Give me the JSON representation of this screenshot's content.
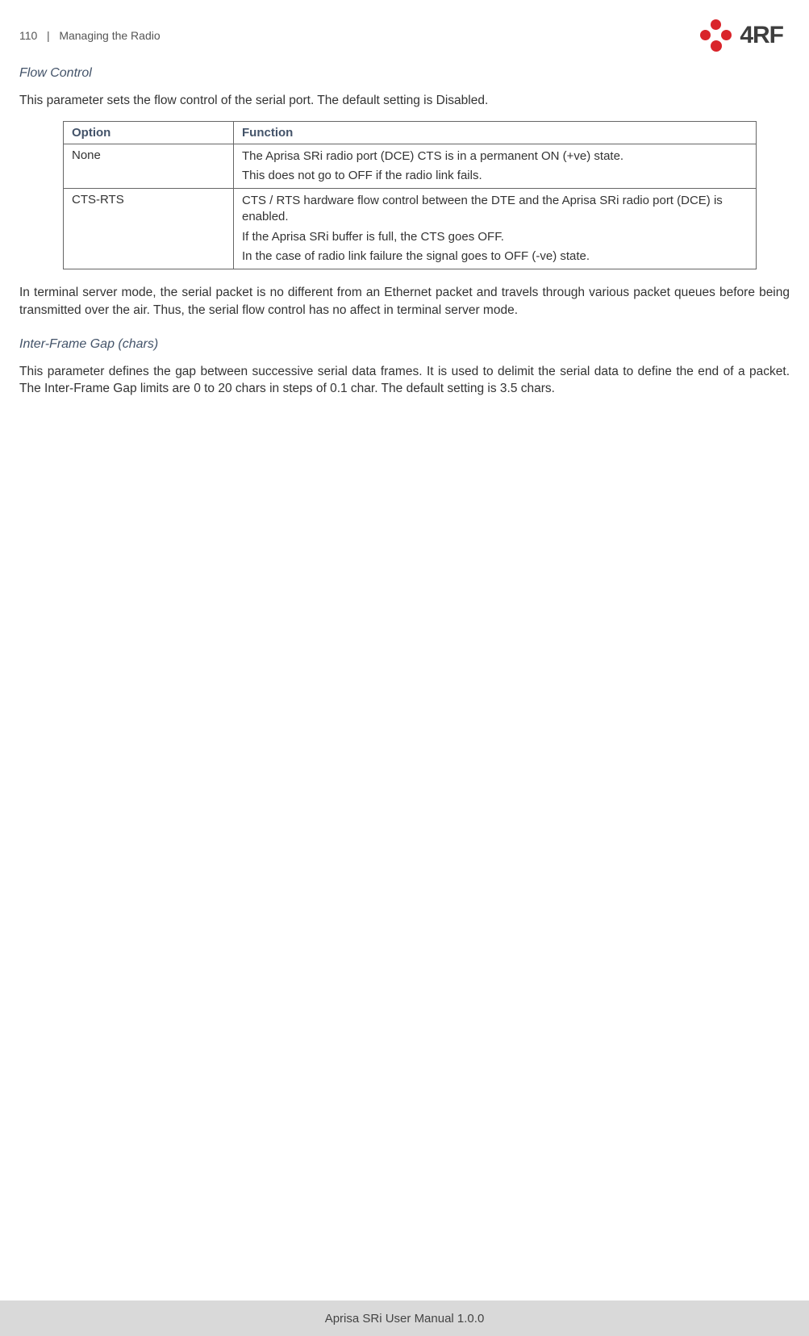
{
  "header": {
    "page_number": "110",
    "section": "Managing the Radio",
    "brand": "4RF"
  },
  "sections": {
    "flow_control": {
      "title": "Flow Control",
      "intro": "This parameter sets the flow control of the serial port. The default setting is Disabled.",
      "table": {
        "headers": {
          "option": "Option",
          "function": "Function"
        },
        "rows": [
          {
            "option": "None",
            "function_lines": [
              "The Aprisa SRi radio port (DCE) CTS is in a permanent ON (+ve) state.",
              "This does not go to OFF if the radio link fails."
            ]
          },
          {
            "option": "CTS-RTS",
            "function_lines": [
              "CTS / RTS hardware flow control between the DTE and the Aprisa SRi radio port (DCE) is enabled.",
              "If the Aprisa SRi buffer is full, the CTS goes OFF.",
              "In the case of radio link failure the signal goes to OFF (-ve) state."
            ]
          }
        ]
      },
      "note": "In terminal server mode, the serial packet is no different from an Ethernet packet and travels through various packet queues before being transmitted over the air. Thus, the serial flow control has no affect in terminal server mode."
    },
    "interframe": {
      "title": "Inter-Frame Gap (chars)",
      "para": "This parameter defines the gap between successive serial data frames. It is used to delimit the serial data to define the end of a packet. The Inter-Frame Gap limits are 0 to 20 chars in steps of 0.1 char. The default setting is 3.5 chars."
    }
  },
  "footer": "Aprisa SRi User Manual 1.0.0"
}
